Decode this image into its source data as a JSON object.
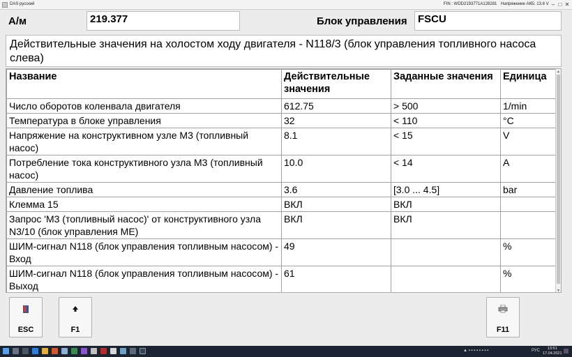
{
  "window": {
    "title": "DAS русский",
    "fin": "FIN : WDD2193771A128281",
    "voltage": "Напряжение АКБ: 13.6 V"
  },
  "header": {
    "am_label": "А/м",
    "am_value": "219.377",
    "ecu_label": "Блок управления",
    "ecu_value": "FSCU"
  },
  "description": "Действительные значения на холостом ходу двигателя - N118/3 (блок управления топливного насоса слева)",
  "table": {
    "columns": [
      "Название",
      "Действительные значения",
      "Заданные значения",
      "Единица"
    ],
    "rows": [
      [
        "Число оборотов коленвала двигателя",
        "612.75",
        "> 500",
        "1/min"
      ],
      [
        "Температура в блоке управления",
        "32",
        "< 110",
        "°C"
      ],
      [
        "Напряжение на конструктивном узле M3 (топливный насос)",
        "8.1",
        "< 15",
        "V"
      ],
      [
        "Потребление тока конструктивного узла M3 (топливный насос)",
        "10.0",
        "< 14",
        "A"
      ],
      [
        "Давление топлива",
        "3.6",
        "[3.0 ... 4.5]",
        "bar"
      ],
      [
        "Клемма 15",
        "ВКЛ",
        "ВКЛ",
        ""
      ],
      [
        "Запрос 'M3 (топливный насос)' от конструктивного узла N3/10 (блок управления ME)",
        "ВКЛ",
        "ВКЛ",
        ""
      ],
      [
        "ШИМ-сигнал N118 (блок управления топливным насосом) - Вход",
        "49",
        "",
        "%"
      ],
      [
        "ШИМ-сигнал N118 (блок управления топливным насосом) - Выход",
        "61",
        "",
        "%"
      ]
    ]
  },
  "buttons": {
    "esc": {
      "label": "ESC",
      "icon": "book-icon"
    },
    "f1": {
      "label": "F1",
      "icon": "arrow-up-icon"
    },
    "f11": {
      "label": "F11",
      "icon": "printer-icon"
    }
  },
  "taskbar": {
    "lang": "РУС",
    "time": "13:51",
    "date": "17.04.2021"
  }
}
